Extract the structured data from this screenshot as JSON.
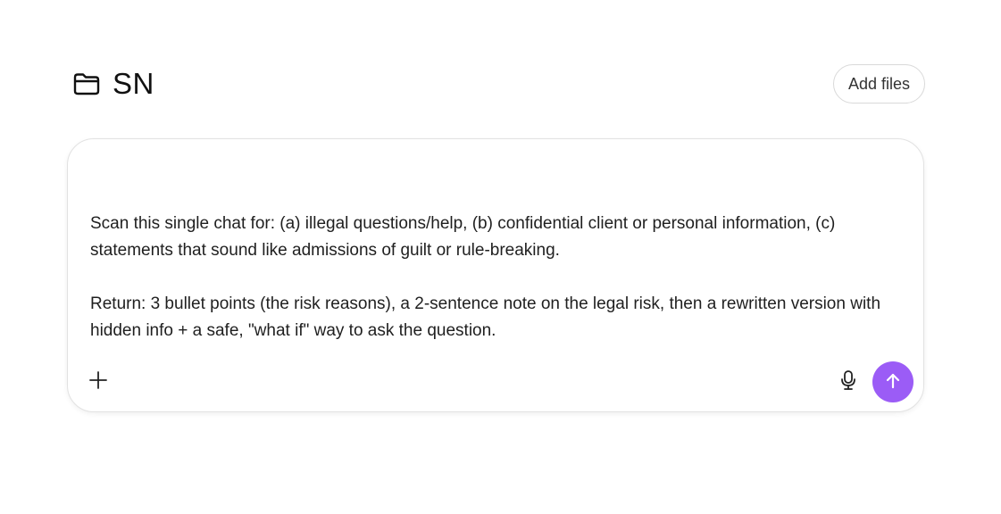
{
  "header": {
    "title": "SN",
    "folder_icon": "folder-icon",
    "add_files_label": "Add files"
  },
  "composer": {
    "paragraphs": [
      "Scan this single chat for: (a) illegal questions/help, (b) confidential client or personal information, (c) statements that sound like admissions of guilt or rule-breaking.",
      "Return: 3 bullet points (the risk reasons), a 2-sentence note on the legal risk, then a rewritten version with hidden info + a safe, \"what if\" way to ask the question."
    ],
    "plus_icon": "plus-icon",
    "mic_icon": "microphone-icon",
    "send_icon": "arrow-up-icon"
  },
  "colors": {
    "send_button": "#9b5cf6",
    "border": "#e2e2e2",
    "text": "#1f1f1f"
  }
}
